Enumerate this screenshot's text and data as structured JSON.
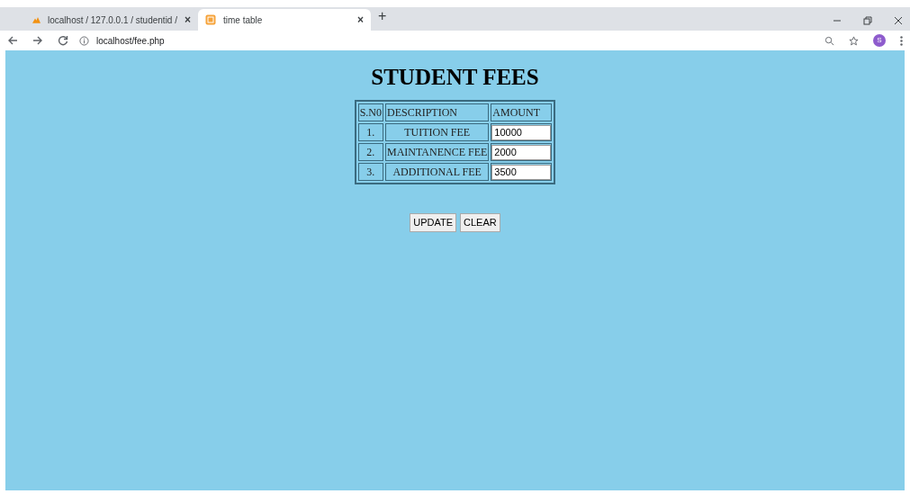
{
  "browser": {
    "tabs": [
      {
        "title": "localhost / 127.0.0.1 / studentid /",
        "selected": false,
        "close": "×"
      },
      {
        "title": "time table",
        "selected": true,
        "close": "×"
      }
    ],
    "new_tab": "+",
    "address": "localhost/fee.php",
    "profile": "S"
  },
  "page": {
    "heading": "STUDENT FEES",
    "columns": [
      "S.N0",
      "DESCRIPTION",
      "AMOUNT"
    ],
    "rows": [
      {
        "sno": "1.",
        "description": "TUITION FEE",
        "amount": "10000"
      },
      {
        "sno": "2.",
        "description": "MAINTANENCE FEE",
        "amount": "2000"
      },
      {
        "sno": "3.",
        "description": "ADDITIONAL FEE",
        "amount": "3500"
      }
    ],
    "buttons": [
      "UPDATE",
      "CLEAR"
    ]
  }
}
